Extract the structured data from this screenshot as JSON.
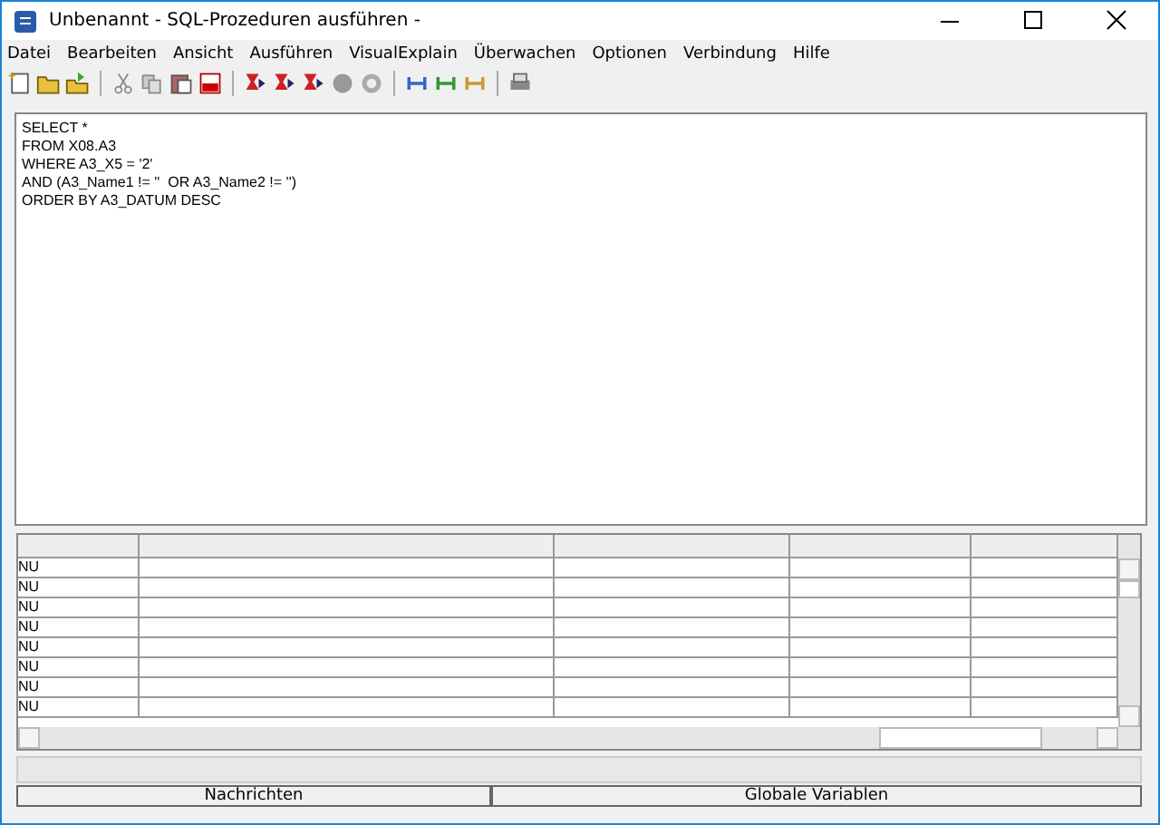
{
  "window": {
    "title": "Unbenannt - SQL-Prozeduren ausführen -"
  },
  "menu": [
    "Datei",
    "Bearbeiten",
    "Ansicht",
    "Ausführen",
    "VisualExplain",
    "Überwachen",
    "Optionen",
    "Verbindung",
    "Hilfe"
  ],
  "editor": {
    "lines": [
      "SELECT *",
      "FROM X08.A3",
      "WHERE A3_X5 = '2'",
      "AND (A3_Name1 != ''  OR A3_Name2 != '')",
      "ORDER BY A3_DATUM DESC"
    ]
  },
  "results": {
    "rows": [
      [
        "NU"
      ],
      [
        "NU"
      ],
      [
        "NU"
      ],
      [
        "NU"
      ],
      [
        "NU"
      ],
      [
        "NU"
      ],
      [
        "NU"
      ],
      [
        "NU"
      ]
    ]
  },
  "tabs": [
    {
      "label": "Nachrichten"
    },
    {
      "label": "Globale Variablen"
    }
  ]
}
